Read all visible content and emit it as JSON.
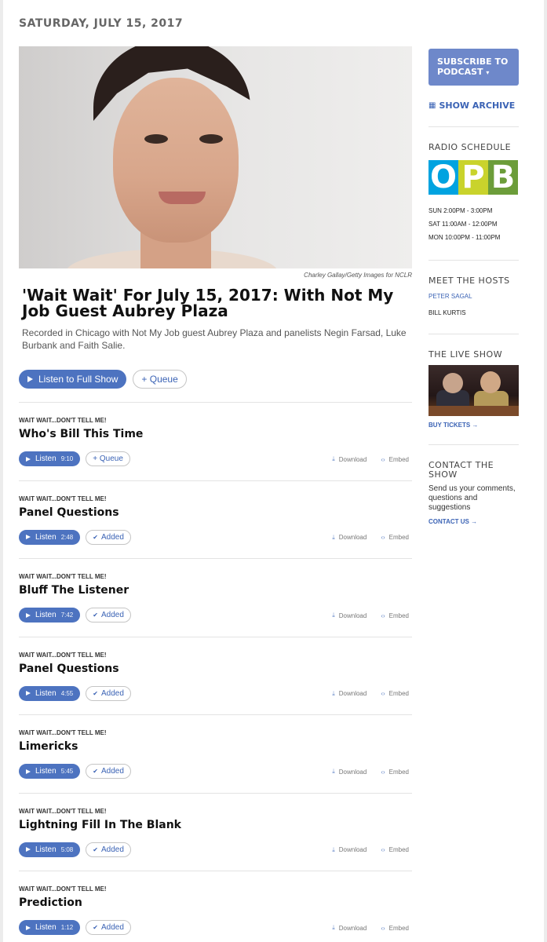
{
  "date": "SATURDAY, JULY 15, 2017",
  "hero": {
    "credit": "Charley Gallay/Getty Images for NCLR"
  },
  "episode": {
    "title": "'Wait Wait' For July 15, 2017: With Not My Job Guest Aubrey Plaza",
    "teaser": "Recorded in Chicago with Not My Job guest Aubrey Plaza and panelists Negin Farsad, Luke Burbank and Faith Salie.",
    "listen_label": "Listen to Full Show",
    "queue_label": "+ Queue"
  },
  "segments": [
    {
      "program": "WAIT WAIT...DON'T TELL ME!",
      "title": "Who's Bill This Time",
      "listen": "Listen",
      "duration": "9:10",
      "queue": "+ Queue",
      "added": false
    },
    {
      "program": "WAIT WAIT...DON'T TELL ME!",
      "title": "Panel Questions",
      "listen": "Listen",
      "duration": "2:48",
      "queue": "Added",
      "added": true
    },
    {
      "program": "WAIT WAIT...DON'T TELL ME!",
      "title": "Bluff The Listener",
      "listen": "Listen",
      "duration": "7:42",
      "queue": "Added",
      "added": true
    },
    {
      "program": "WAIT WAIT...DON'T TELL ME!",
      "title": "Panel Questions",
      "listen": "Listen",
      "duration": "4:55",
      "queue": "Added",
      "added": true
    },
    {
      "program": "WAIT WAIT...DON'T TELL ME!",
      "title": "Limericks",
      "listen": "Listen",
      "duration": "5:45",
      "queue": "Added",
      "added": true
    },
    {
      "program": "WAIT WAIT...DON'T TELL ME!",
      "title": "Lightning Fill In The Blank",
      "listen": "Listen",
      "duration": "5:08",
      "queue": "Added",
      "added": true
    },
    {
      "program": "WAIT WAIT...DON'T TELL ME!",
      "title": "Prediction",
      "listen": "Listen",
      "duration": "1:12",
      "queue": "Added",
      "added": true
    }
  ],
  "segment_tools": {
    "download": "Download",
    "embed": "Embed"
  },
  "sidebar": {
    "subscribe": "SUBSCRIBE TO PODCAST",
    "archive": "SHOW ARCHIVE",
    "radio_heading": "RADIO SCHEDULE",
    "station_letters": [
      "O",
      "P",
      "B"
    ],
    "station_colors": [
      "#00a3e0",
      "#c9d32c",
      "#6c9d3a"
    ],
    "schedule": [
      "SUN 2:00PM - 3:00PM",
      "SAT 11:00AM - 12:00PM",
      "MON 10:00PM - 11:00PM"
    ],
    "hosts_heading": "MEET THE HOSTS",
    "hosts": [
      "PETER SAGAL",
      "BILL KURTIS"
    ],
    "live_heading": "THE LIVE SHOW",
    "buy_tickets": "BUY TICKETS →",
    "contact_heading": "CONTACT THE SHOW",
    "contact_text": "Send us your comments, questions and suggestions",
    "contact_link": "CONTACT US →"
  },
  "colors": {
    "accent": "#4d73c0",
    "link": "#3b63b5",
    "subscribe_bg": "#6e88ca"
  }
}
